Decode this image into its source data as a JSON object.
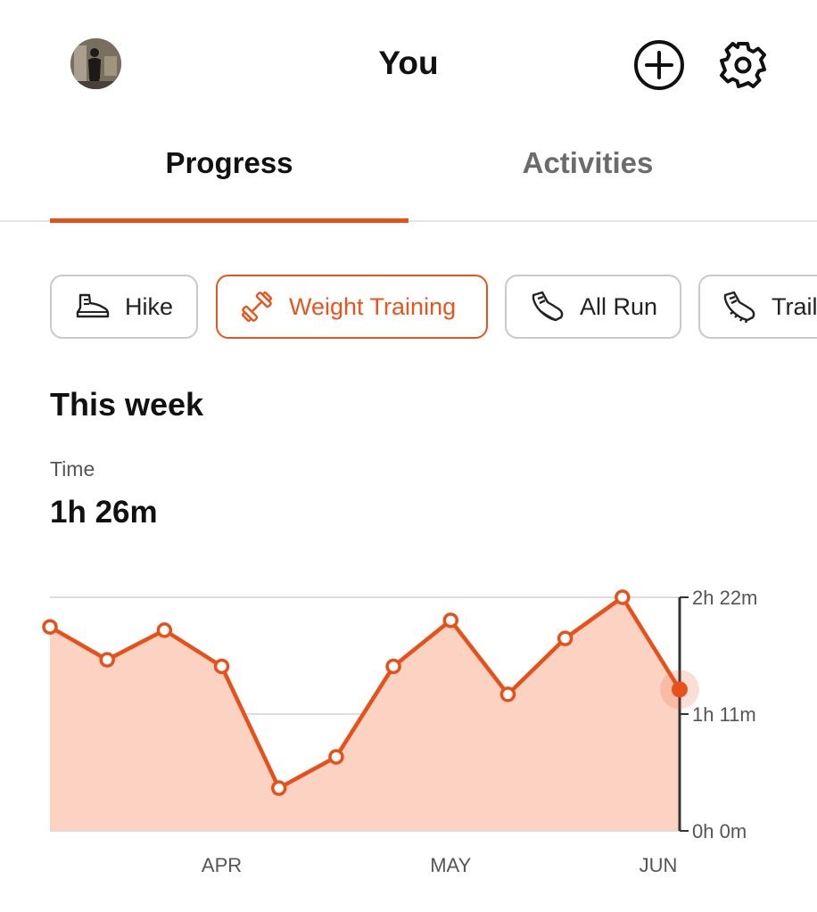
{
  "header": {
    "title": "You",
    "avatar_icon": "profile-photo",
    "add_icon": "plus-circle-icon",
    "settings_icon": "gear-icon"
  },
  "tabs": [
    {
      "label": "Progress",
      "selected": true
    },
    {
      "label": "Activities",
      "selected": false
    }
  ],
  "activity_filters": [
    {
      "label": "Hike",
      "icon": "hiking-boot-icon",
      "selected": false
    },
    {
      "label": "Weight Training",
      "icon": "dumbbell-icon",
      "selected": true
    },
    {
      "label": "All Run",
      "icon": "running-shoe-icon",
      "selected": false
    },
    {
      "label": "Trail",
      "icon": "trail-shoe-icon",
      "selected": false
    }
  ],
  "summary": {
    "period": "This week",
    "metric_label": "Time",
    "metric_value": "1h 26m"
  },
  "colors": {
    "accent": "#e8501a",
    "area_fill": "#fcd3c3",
    "inactive_tab": "#6b6b6b"
  },
  "chart_data": {
    "type": "area",
    "x_tick_labels": [
      "APR",
      "MAY",
      "JUN"
    ],
    "y_tick_labels": [
      "2h 22m",
      "1h 11m",
      "0h 0m"
    ],
    "ylim_minutes": [
      0,
      142
    ],
    "y_axis_position": "right",
    "grid": true,
    "series": [
      {
        "values_minutes": [
          124,
          104,
          122,
          100,
          26,
          45,
          100,
          128,
          83,
          117,
          142,
          86
        ],
        "highlight_last": true
      }
    ]
  }
}
